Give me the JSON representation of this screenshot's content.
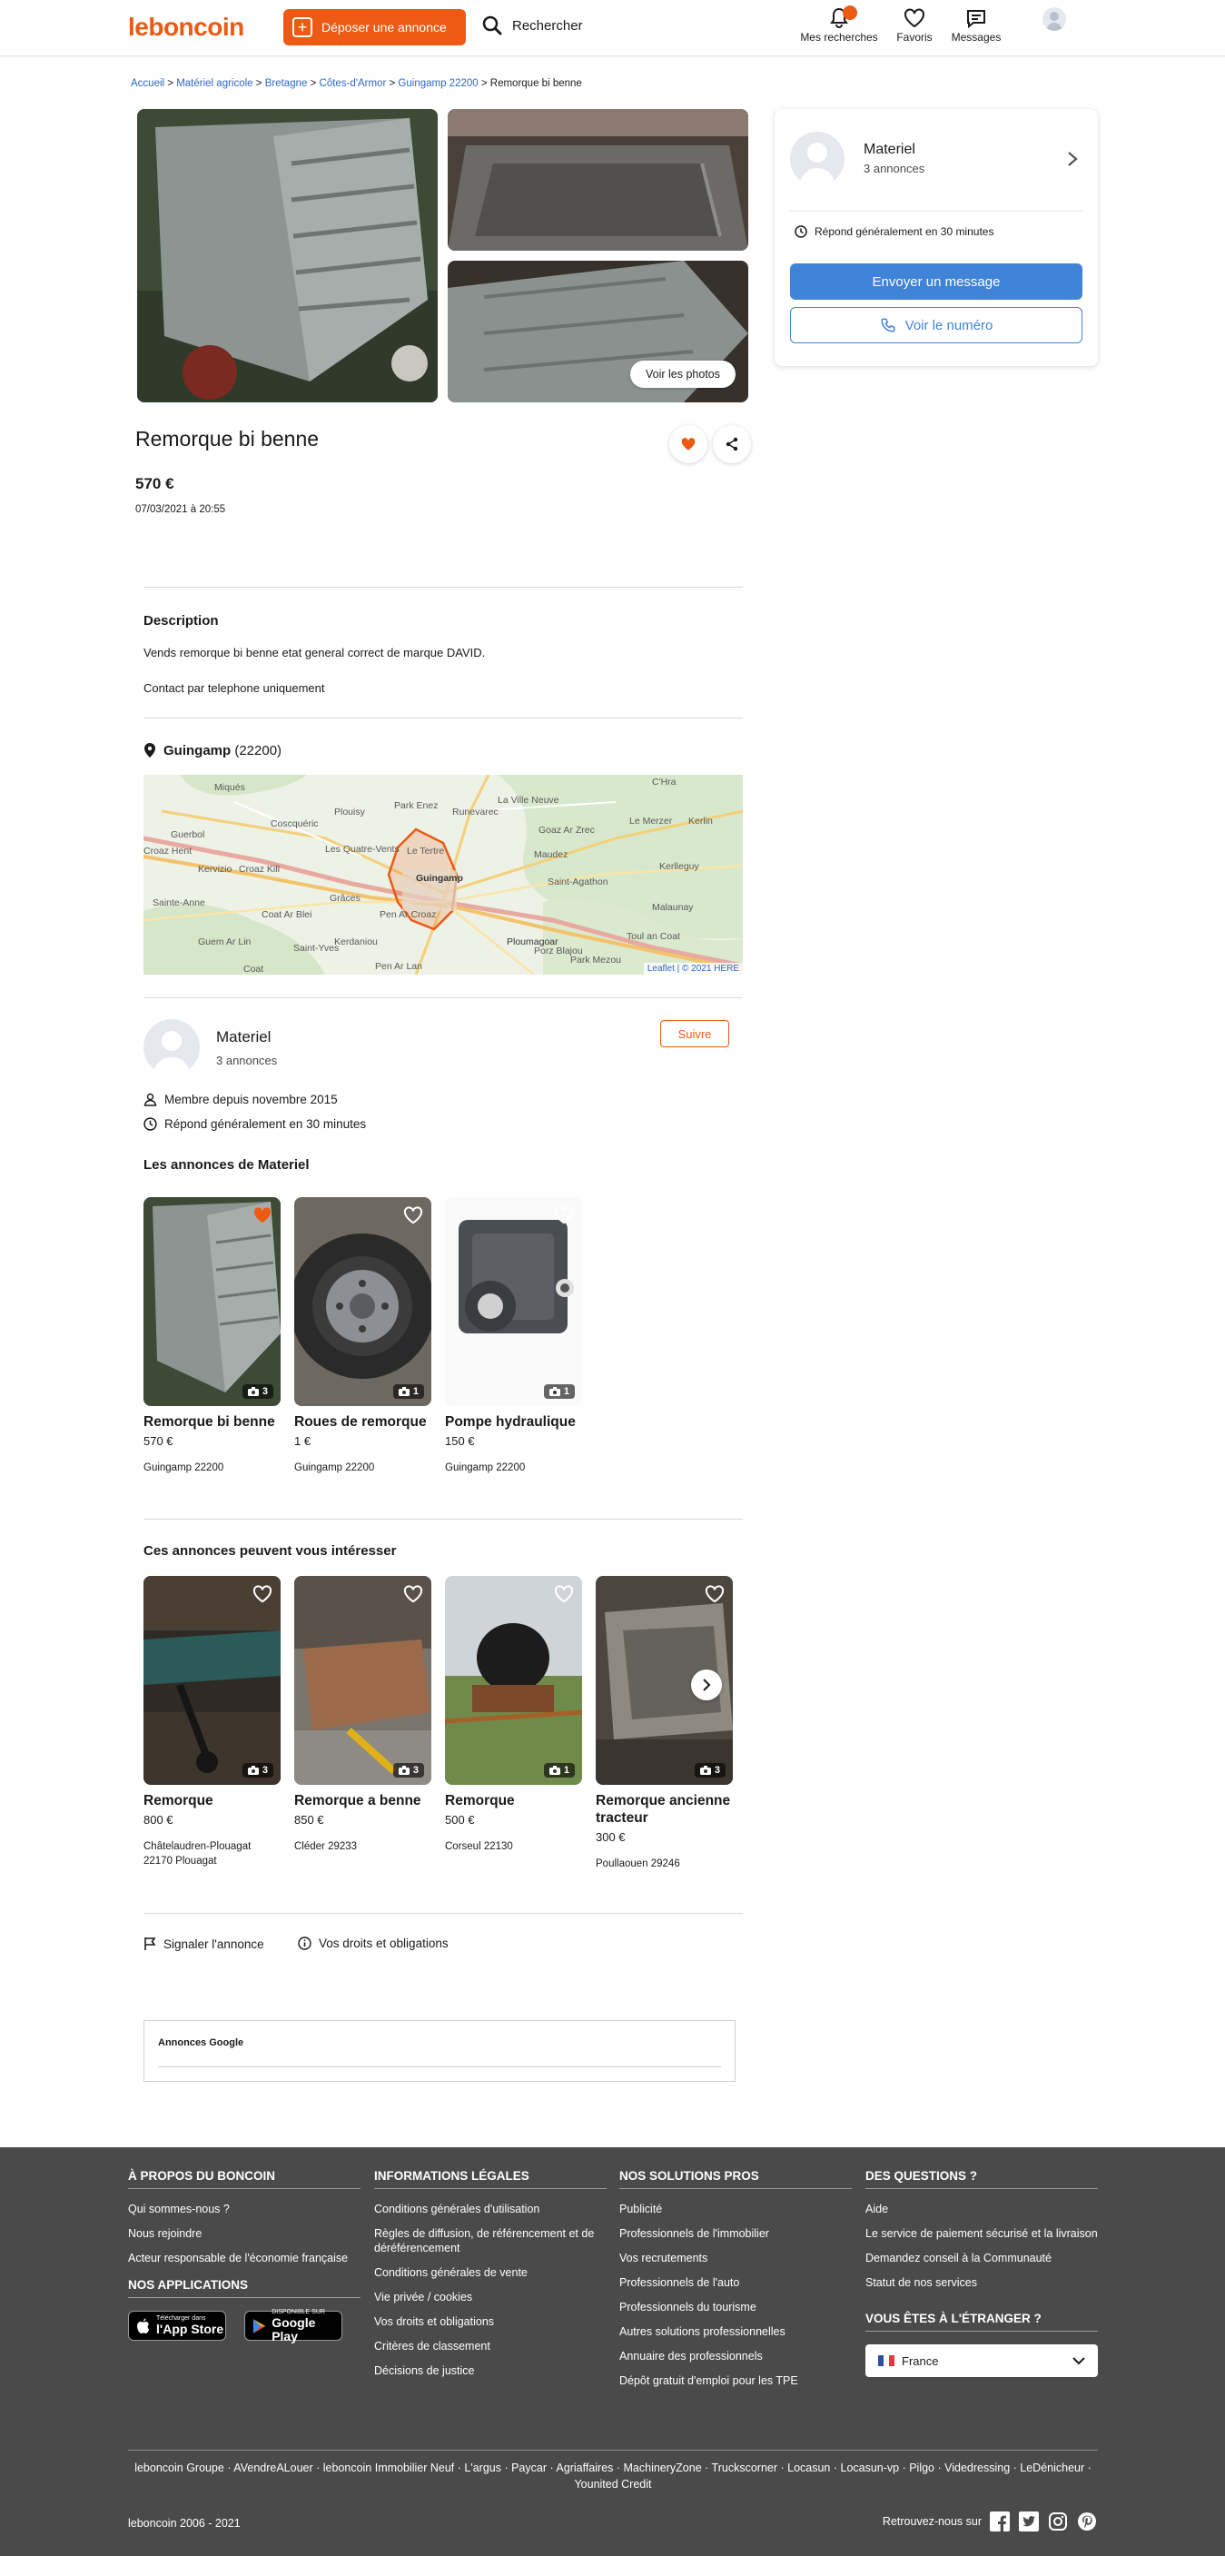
{
  "header": {
    "logo": "leboncoin",
    "deposer": "Déposer une annonce",
    "rechercher": "Rechercher",
    "nav": [
      {
        "label": "Mes recherches",
        "icon": "bell-icon"
      },
      {
        "label": "Favoris",
        "icon": "heart-icon"
      },
      {
        "label": "Messages",
        "icon": "message-icon"
      }
    ]
  },
  "breadcrumb": {
    "items": [
      "Accueil",
      "Matériel agricole",
      "Bretagne",
      "Côtes-d'Armor",
      "Guingamp 22200"
    ],
    "current": "Remorque bi benne",
    "sep": ">"
  },
  "ad": {
    "photos_button": "Voir les photos",
    "title": "Remorque bi benne",
    "price": "570 €",
    "date": "07/03/2021 à 20:55",
    "description_title": "Description",
    "description_lines": [
      "Vends remorque bi benne etat general correct de marque DAVID.",
      "Contact par telephone uniquement"
    ],
    "location_city": "Guingamp",
    "location_zip": "(22200)"
  },
  "map": {
    "labels": [
      "Miqués",
      "Plouisy",
      "Park Enez",
      "Runevarec",
      "La Ville Neuve",
      "Guerbol",
      "Coscquéric",
      "Les Quatre-Vents",
      "Le Tertre",
      "Maudez",
      "Goaz Ar Zrec",
      "Croaz Hent",
      "Kervizio",
      "Croaz Kill",
      "Guingamp",
      "Le Merzer",
      "Kerlin",
      "Saint-Agathon",
      "Sainte-Anne",
      "Grâces",
      "Pen Ar Croaz",
      "Kerlleguy",
      "Coat Ar Blei",
      "Malaunay",
      "Guem Ar Lin",
      "Kerdaniou",
      "Ploumagoar",
      "Toul an Coat",
      "Saint-Yves",
      "Porz Blajou",
      "Park Mezou",
      "Pen Ar Lan",
      "Coat",
      "C'Hra"
    ],
    "attribution_link": "Leaflet",
    "attribution_text": "| © 2021 HERE"
  },
  "contact_card": {
    "name": "Materiel",
    "count": "3 annonces",
    "response": "Répond généralement en 30 minutes",
    "btn_message": "Envoyer un message",
    "btn_phone": "Voir le numéro"
  },
  "seller": {
    "name": "Materiel",
    "count": "3 annonces",
    "follow": "Suivre",
    "member_since": "Membre depuis novembre 2015",
    "response": "Répond généralement en 30 minutes"
  },
  "seller_ads": {
    "title": "Les annonces de Materiel",
    "items": [
      {
        "title": "Remorque bi benne",
        "price": "570 €",
        "location": "Guingamp 22200",
        "photos": "3"
      },
      {
        "title": "Roues de remorque",
        "price": "1 €",
        "location": "Guingamp 22200",
        "photos": "1"
      },
      {
        "title": "Pompe hydraulique",
        "price": "150 €",
        "location": "Guingamp 22200",
        "photos": "1"
      }
    ]
  },
  "similar_ads": {
    "title": "Ces annonces peuvent vous intéresser",
    "items": [
      {
        "title": "Remorque",
        "price": "800 €",
        "location": "Châtelaudren-Plouagat 22170 Plouagat",
        "photos": "3"
      },
      {
        "title": "Remorque a benne",
        "price": "850 €",
        "location": "Cléder 29233",
        "photos": "3"
      },
      {
        "title": "Remorque",
        "price": "500 €",
        "location": "Corseul 22130",
        "photos": "1"
      },
      {
        "title": "Remorque ancienne tracteur",
        "price": "300 €",
        "location": "Poullaouen 29246",
        "photos": "3"
      }
    ]
  },
  "actions": {
    "report": "Signaler l'annonce",
    "rights": "Vos droits et obligations"
  },
  "google": {
    "title": "Annonces Google"
  },
  "footer": {
    "cols": [
      {
        "title": "À PROPOS DU BONCOIN",
        "links": [
          "Qui sommes-nous ?",
          "Nous rejoindre",
          "Acteur responsable de l'économie française"
        ]
      },
      {
        "title": "INFORMATIONS LÉGALES",
        "links": [
          "Conditions générales d'utilisation",
          "Règles de diffusion, de référencement et de déréférencement",
          "Conditions générales de vente",
          "Vie privée / cookies",
          "Vos droits et obligations",
          "Critères de classement",
          "Décisions de justice"
        ]
      },
      {
        "title": "NOS SOLUTIONS PROS",
        "links": [
          "Publicité",
          "Professionnels de l'immobilier",
          "Vos recrutements",
          "Professionnels de l'auto",
          "Professionnels du tourisme",
          "Autres solutions professionnelles",
          "Annuaire des professionnels",
          "Dépôt gratuit d'emploi pour les TPE"
        ]
      },
      {
        "title": "DES QUESTIONS ?",
        "links": [
          "Aide",
          "Le service de paiement sécurisé et la livraison",
          "Demandez conseil à la Communauté",
          "Statut de nos services"
        ]
      }
    ],
    "apps_title": "NOS APPLICATIONS",
    "appstore_small": "Télécharger dans",
    "appstore_big": "l'App Store",
    "googleplay_small": "DISPONIBLE SUR",
    "googleplay_big": "Google Play",
    "abroad_title": "VOUS ÊTES À L'ÉTRANGER ?",
    "country": "France",
    "group_links": "leboncoin Groupe · AVendreALouer · leboncoin Immobilier Neuf · L'argus · Paycar · Agriaffaires · MachineryZone · Truckscorner · Locasun · Locasun-vp · Pilgo · Videdressing · LeDénicheur · Younited Credit",
    "copyright": "leboncoin 2006 - 2021",
    "follow_us": "Retrouvez-nous sur"
  },
  "colors": {
    "brand": "#ec5a13",
    "link": "#3067c6",
    "button": "#4183d7",
    "footer_bg": "#4a4a4a"
  }
}
